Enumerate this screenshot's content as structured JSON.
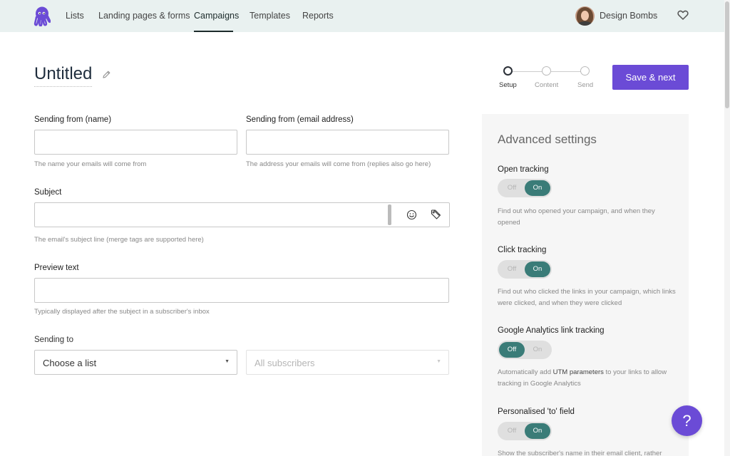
{
  "nav": {
    "items": [
      {
        "label": "Lists"
      },
      {
        "label": "Landing pages & forms"
      },
      {
        "label": "Campaigns",
        "active": true
      },
      {
        "label": "Templates"
      },
      {
        "label": "Reports"
      }
    ],
    "account_name": "Design Bombs",
    "icons": {
      "logo": "octopus-logo-icon",
      "favorite": "heart-icon",
      "caret": "caret-down-icon"
    }
  },
  "page": {
    "title": "Untitled",
    "edit_icon": "pencil-icon"
  },
  "steps": [
    {
      "label": "Setup",
      "current": true
    },
    {
      "label": "Content",
      "current": false
    },
    {
      "label": "Send",
      "current": false
    }
  ],
  "actions": {
    "save_next": "Save & next"
  },
  "form": {
    "from_name": {
      "label": "Sending from (name)",
      "value": "",
      "help": "The name your emails will come from"
    },
    "from_email": {
      "label": "Sending from (email address)",
      "value": "",
      "help": "The address your emails will come from (replies also go here)"
    },
    "subject": {
      "label": "Subject",
      "value": "",
      "help": "The email's subject line (merge tags are supported here)",
      "icons": [
        "smiley-icon",
        "tag-icon"
      ]
    },
    "preview": {
      "label": "Preview text",
      "value": "",
      "help": "Typically displayed after the subject in a subscriber's inbox"
    },
    "sending_to": {
      "label": "Sending to",
      "list_select": "Choose a list",
      "segment_select": "All subscribers"
    }
  },
  "advanced": {
    "title": "Advanced settings",
    "toggle_off_label": "Off",
    "toggle_on_label": "On",
    "settings": [
      {
        "label": "Open tracking",
        "state": "On",
        "help": "Find out who opened your campaign, and when they opened"
      },
      {
        "label": "Click tracking",
        "state": "On",
        "help": "Find out who clicked the links in your campaign, which links were clicked, and when they were clicked"
      },
      {
        "label": "Google Analytics link tracking",
        "state": "Off",
        "help_before": "Automatically add ",
        "help_bold": "UTM parameters",
        "help_after": " to your links to allow tracking in Google Analytics"
      },
      {
        "label": "Personalised 'to' field",
        "state": "On",
        "help": "Show the subscriber's name in their email client, rather"
      }
    ]
  },
  "help_button": {
    "label": "?"
  },
  "colors": {
    "accent": "#6b4bd6",
    "toggle_on": "#3a7c78",
    "topbar": "#e9f1f0",
    "panel": "#f6f6f6"
  }
}
